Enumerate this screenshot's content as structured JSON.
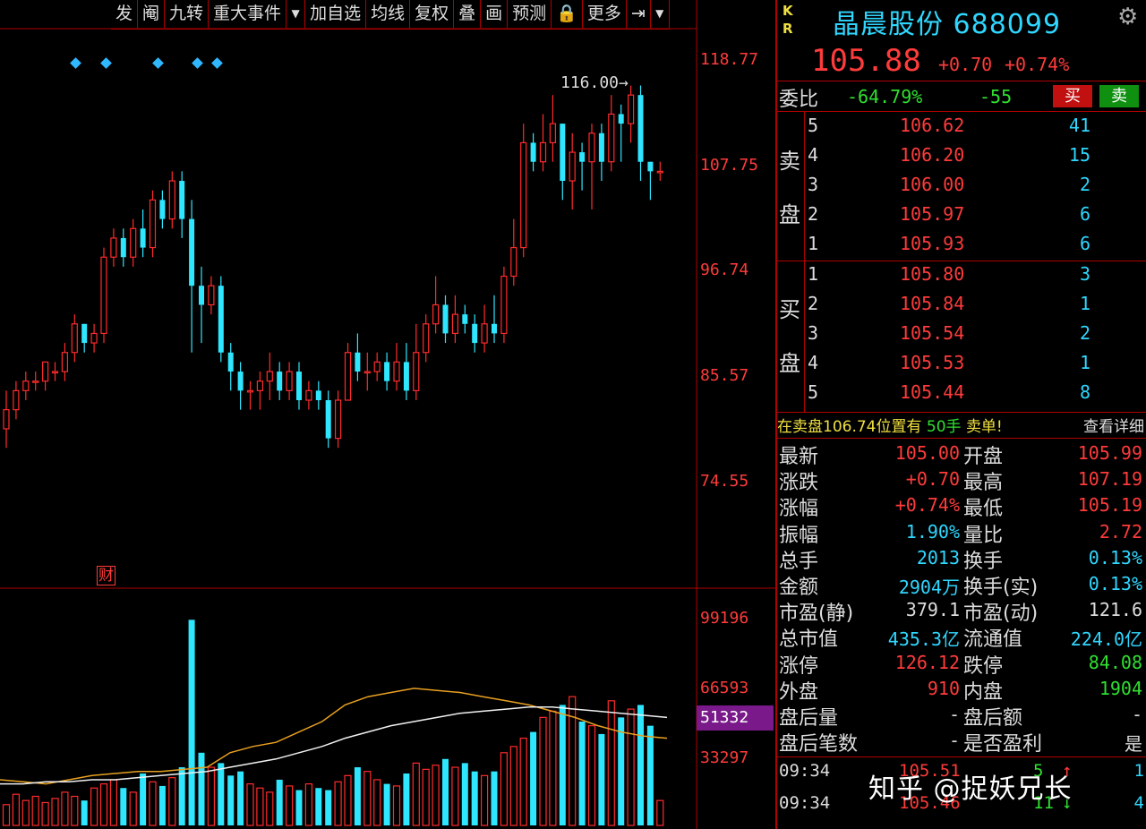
{
  "toolbar": {
    "items": [
      "发",
      "阉",
      "九转",
      "重大事件",
      "▼",
      "加自选",
      "均线",
      "复权",
      "叠",
      "画",
      "预测",
      "🔒",
      "更多",
      "⇥",
      "▼"
    ]
  },
  "chart_data": {
    "type": "candlestick",
    "price_axis": [
      "118.77",
      "107.75",
      "96.74",
      "85.57",
      "74.55"
    ],
    "volume_axis": [
      "99196",
      "66593",
      "51332",
      "33297"
    ],
    "high_label": "116.00",
    "badge": "财",
    "candles": [
      [
        80,
        82,
        78,
        84
      ],
      [
        82,
        84,
        81,
        85
      ],
      [
        84,
        85,
        83,
        86
      ],
      [
        85,
        85,
        84,
        86
      ],
      [
        85,
        87,
        84,
        87
      ],
      [
        86,
        86,
        85,
        87
      ],
      [
        86,
        88,
        85,
        89
      ],
      [
        88,
        91,
        87,
        92
      ],
      [
        91,
        89,
        88,
        91
      ],
      [
        89,
        90,
        88,
        91
      ],
      [
        90,
        98,
        89,
        99
      ],
      [
        98,
        100,
        97,
        101
      ],
      [
        100,
        98,
        97,
        101
      ],
      [
        98,
        101,
        97,
        102
      ],
      [
        101,
        99,
        98,
        103
      ],
      [
        99,
        104,
        98,
        105
      ],
      [
        104,
        102,
        101,
        105
      ],
      [
        102,
        106,
        101,
        107
      ],
      [
        106,
        102,
        100,
        107
      ],
      [
        102,
        95,
        88,
        104
      ],
      [
        95,
        93,
        89,
        97
      ],
      [
        93,
        95,
        92,
        96
      ],
      [
        95,
        88,
        87,
        96
      ],
      [
        88,
        86,
        84,
        89
      ],
      [
        86,
        84,
        82,
        87
      ],
      [
        84,
        84,
        82,
        85
      ],
      [
        84,
        85,
        82,
        86
      ],
      [
        85,
        86,
        83,
        88
      ],
      [
        86,
        84,
        83,
        87
      ],
      [
        84,
        86,
        83,
        87
      ],
      [
        86,
        83,
        82,
        87
      ],
      [
        83,
        84,
        82,
        85
      ],
      [
        84,
        83,
        82,
        85
      ],
      [
        83,
        79,
        78,
        84
      ],
      [
        79,
        83,
        78,
        84
      ],
      [
        83,
        88,
        83,
        89
      ],
      [
        88,
        86,
        85,
        90
      ],
      [
        86,
        86,
        84,
        88
      ],
      [
        86,
        87,
        85,
        88
      ],
      [
        87,
        85,
        84,
        88
      ],
      [
        85,
        87,
        84,
        89
      ],
      [
        87,
        84,
        83,
        89
      ],
      [
        84,
        88,
        83,
        91
      ],
      [
        88,
        91,
        87,
        92
      ],
      [
        91,
        93,
        90,
        96
      ],
      [
        93,
        90,
        89,
        94
      ],
      [
        90,
        92,
        89,
        94
      ],
      [
        92,
        91,
        90,
        93
      ],
      [
        91,
        89,
        88,
        92
      ],
      [
        89,
        91,
        88,
        93
      ],
      [
        91,
        90,
        89,
        94
      ],
      [
        90,
        96,
        89,
        97
      ],
      [
        96,
        99,
        95,
        102
      ],
      [
        99,
        110,
        98,
        112
      ],
      [
        110,
        108,
        107,
        111
      ],
      [
        108,
        110,
        107,
        113
      ],
      [
        110,
        112,
        108,
        115
      ],
      [
        112,
        106,
        104,
        112
      ],
      [
        106,
        109,
        103,
        111
      ],
      [
        109,
        108,
        105,
        110
      ],
      [
        108,
        111,
        103,
        112
      ],
      [
        111,
        108,
        106,
        112
      ],
      [
        108,
        113,
        107,
        115
      ],
      [
        113,
        112,
        108,
        114
      ],
      [
        112,
        115,
        110,
        116
      ],
      [
        115,
        108,
        106,
        116
      ],
      [
        108,
        107,
        104,
        108
      ],
      [
        107,
        107,
        106,
        108
      ]
    ],
    "volumes": [
      10,
      15,
      12,
      14,
      11,
      13,
      16,
      14,
      12,
      18,
      20,
      22,
      18,
      16,
      25,
      21,
      19,
      23,
      28,
      99,
      35,
      28,
      30,
      24,
      26,
      20,
      18,
      16,
      22,
      19,
      17,
      20,
      18,
      17,
      21,
      24,
      28,
      26,
      22,
      20,
      19,
      25,
      30,
      27,
      29,
      32,
      28,
      30,
      26,
      24,
      26,
      35,
      38,
      42,
      45,
      52,
      55,
      58,
      62,
      50,
      48,
      44,
      60,
      52,
      56,
      58,
      48,
      12
    ],
    "ma1": [
      22,
      21,
      20,
      22,
      24,
      25,
      26,
      26,
      27,
      28,
      35,
      38,
      40,
      45,
      50,
      58,
      62,
      64,
      66,
      65,
      64,
      62,
      60,
      58,
      55,
      52,
      48,
      45,
      43,
      42
    ],
    "ma2": [
      20,
      20,
      21,
      21,
      22,
      22,
      23,
      24,
      25,
      26,
      28,
      30,
      32,
      35,
      38,
      42,
      45,
      48,
      50,
      52,
      54,
      55,
      56,
      57,
      57,
      56,
      55,
      54,
      53,
      52
    ]
  },
  "quote": {
    "kr": [
      "K",
      "R"
    ],
    "name": "晶晨股份 688099",
    "price": "105.88",
    "change": "+0.70",
    "change_pct": "+0.74%",
    "weibi_label": "委比",
    "weibi": "-64.79%",
    "weicha": "-55",
    "buy": "买",
    "sell": "卖",
    "sell_side": [
      "卖",
      "盘"
    ],
    "buy_side": [
      "买",
      "盘"
    ],
    "asks": [
      {
        "level": "5",
        "price": "106.62",
        "vol": "41"
      },
      {
        "level": "4",
        "price": "106.20",
        "vol": "15"
      },
      {
        "level": "3",
        "price": "106.00",
        "vol": "2"
      },
      {
        "level": "2",
        "price": "105.97",
        "vol": "6"
      },
      {
        "level": "1",
        "price": "105.93",
        "vol": "6"
      }
    ],
    "bids": [
      {
        "level": "1",
        "price": "105.80",
        "vol": "3"
      },
      {
        "level": "2",
        "price": "105.84",
        "vol": "1"
      },
      {
        "level": "3",
        "price": "105.54",
        "vol": "2"
      },
      {
        "level": "4",
        "price": "105.53",
        "vol": "1"
      },
      {
        "level": "5",
        "price": "105.44",
        "vol": "8"
      }
    ],
    "notice": "在卖盘106.74位置有",
    "notice_hands": "50手",
    "notice_type": "卖单!",
    "notice_detail": "查看详细",
    "stats": [
      [
        "最新",
        "105.00",
        "red",
        "开盘",
        "105.99",
        "red"
      ],
      [
        "涨跌",
        "+0.70",
        "red",
        "最高",
        "107.19",
        "red"
      ],
      [
        "涨幅",
        "+0.74%",
        "red",
        "最低",
        "105.19",
        "red"
      ],
      [
        "振幅",
        "1.90%",
        "cyan",
        "量比",
        "2.72",
        "red"
      ],
      [
        "总手",
        "2013",
        "cyan",
        "换手",
        "0.13%",
        "cyan"
      ],
      [
        "金额",
        "2904万",
        "cyan",
        "换手(实)",
        "0.13%",
        "cyan"
      ],
      [
        "市盈(静)",
        "379.1",
        "white",
        "市盈(动)",
        "121.6",
        "white"
      ],
      [
        "总市值",
        "435.3亿",
        "cyan",
        "流通值",
        "224.0亿",
        "cyan"
      ],
      [
        "涨停",
        "126.12",
        "red",
        "跌停",
        "84.08",
        "green"
      ],
      [
        "外盘",
        "910",
        "red",
        "内盘",
        "1904",
        "green"
      ],
      [
        "盘后量",
        "-",
        "white",
        "盘后额",
        "-",
        "white"
      ],
      [
        "盘后笔数",
        "-",
        "white",
        "是否盈利",
        "是",
        "white"
      ]
    ],
    "ticks": [
      {
        "time": "09:34",
        "price": "105.51",
        "vol": "5",
        "dir": "↑",
        "last": "1"
      },
      {
        "time": "09:34",
        "price": "105.46",
        "vol": "11",
        "dir": "↓",
        "last": "4"
      }
    ]
  },
  "watermark": "知乎 @捉妖兄长"
}
